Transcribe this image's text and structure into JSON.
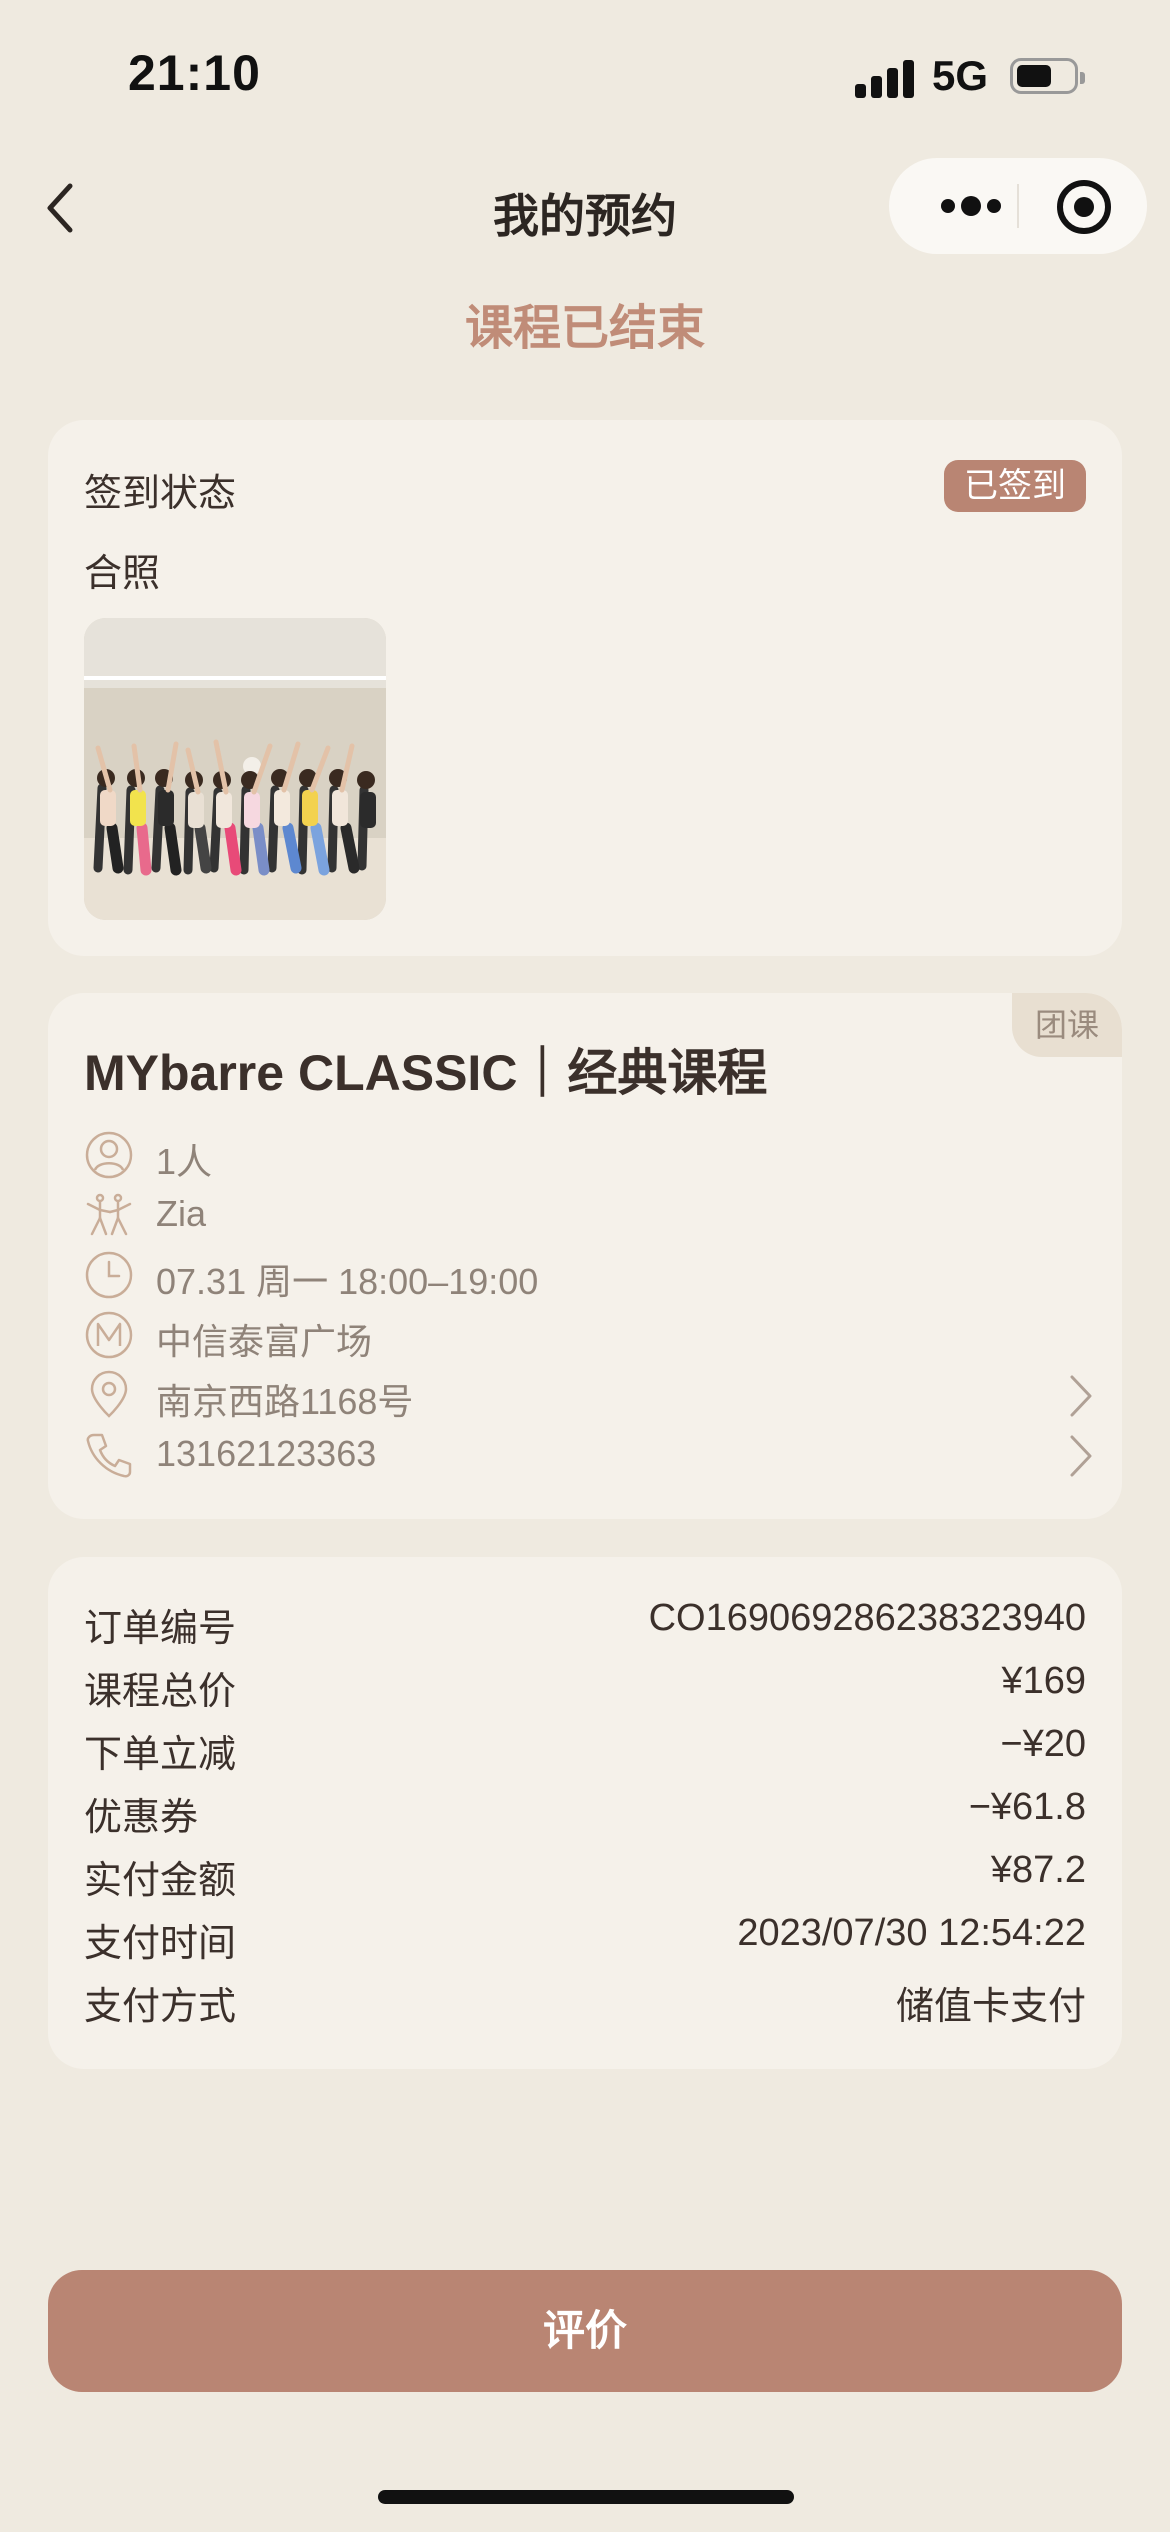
{
  "status_bar": {
    "time": "21:10",
    "network": "5G"
  },
  "nav": {
    "title": "我的预约"
  },
  "course_status": "课程已结束",
  "checkin": {
    "status_label": "签到状态",
    "status_badge": "已签到",
    "photo_label": "合照"
  },
  "course": {
    "tag": "团课",
    "title": "MYbarre CLASSIC｜经典课程",
    "people": "1人",
    "coach": "Zia",
    "datetime": "07.31 周一 18:00–19:00",
    "studio": "中信泰富广场",
    "address": "南京西路1168号",
    "phone": "13162123363"
  },
  "order": {
    "rows": [
      {
        "key": "订单编号",
        "value": "CO169069286238323940"
      },
      {
        "key": "课程总价",
        "value": "¥169"
      },
      {
        "key": "下单立减",
        "value": "−¥20"
      },
      {
        "key": "优惠券",
        "value": "−¥61.8"
      },
      {
        "key": "实付金额",
        "value": "¥87.2"
      },
      {
        "key": "支付时间",
        "value": "2023/07/30 12:54:22"
      },
      {
        "key": "支付方式",
        "value": "储值卡支付"
      }
    ]
  },
  "review_button": "评价",
  "colors": {
    "accent": "#b98573",
    "status_text": "#c08c78",
    "background": "#efeae0",
    "card": "#f5f1ea"
  }
}
